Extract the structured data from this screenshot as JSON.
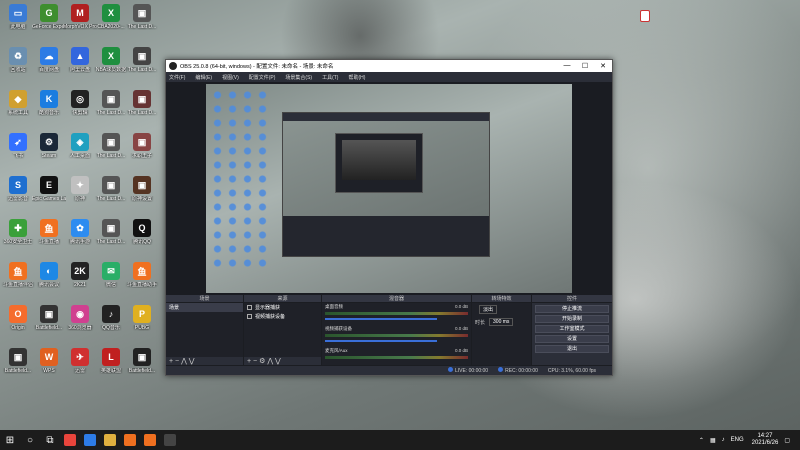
{
  "desktop_icons": [
    {
      "label": "此电脑",
      "color": "#3a7bd5",
      "glyph": "▭",
      "icon": "computer-icon"
    },
    {
      "label": "GeForce Experience",
      "color": "#3e8e2f",
      "glyph": "G",
      "icon": "nvidia-icon"
    },
    {
      "label": "MorphVOX Pro",
      "color": "#b02020",
      "glyph": "M",
      "icon": "morphvox-icon"
    },
    {
      "label": "CBA2020-...",
      "color": "#1f8f3f",
      "glyph": "X",
      "icon": "excel-icon"
    },
    {
      "label": "The Last D...",
      "color": "#555",
      "glyph": "▣",
      "icon": "game-icon"
    },
    {
      "label": "回收站",
      "color": "#6a8fb0",
      "glyph": "♻",
      "icon": "recycle-bin-icon"
    },
    {
      "label": "百度网盘",
      "color": "#2c7be5",
      "glyph": "☁",
      "icon": "baidu-netdisk-icon"
    },
    {
      "label": "阿里云盘",
      "color": "#3366dd",
      "glyph": "▲",
      "icon": "aliyun-icon"
    },
    {
      "label": "NBA球员数据",
      "color": "#1f8f3f",
      "glyph": "X",
      "icon": "excel-icon"
    },
    {
      "label": "The Last D...",
      "color": "#444",
      "glyph": "▣",
      "icon": "game-icon"
    },
    {
      "label": "系统工具",
      "color": "#d0a030",
      "glyph": "◆",
      "icon": "tool-icon"
    },
    {
      "label": "酷狗音乐",
      "color": "#1b7de0",
      "glyph": "K",
      "icon": "kugou-icon"
    },
    {
      "label": "快剪辑",
      "color": "#222",
      "glyph": "◎",
      "icon": "editor-icon"
    },
    {
      "label": "The Last D...",
      "color": "#555",
      "glyph": "▣",
      "icon": "game-icon"
    },
    {
      "label": "The Last D...",
      "color": "#663333",
      "glyph": "▣",
      "icon": "game-icon"
    },
    {
      "label": "飞书",
      "color": "#3370ff",
      "glyph": "➶",
      "icon": "feishu-icon"
    },
    {
      "label": "Steam",
      "color": "#1b2838",
      "glyph": "⚙",
      "icon": "steam-icon"
    },
    {
      "label": "人工桌面",
      "color": "#20a0c0",
      "glyph": "◈",
      "icon": "desktop-tool-icon"
    },
    {
      "label": "The Last D...",
      "color": "#555",
      "glyph": "▣",
      "icon": "game-icon"
    },
    {
      "label": "求职王子",
      "color": "#884444",
      "glyph": "▣",
      "icon": "photo-icon"
    },
    {
      "label": "迅雷影音",
      "color": "#1f6fd0",
      "glyph": "S",
      "icon": "player-icon"
    },
    {
      "label": "Epic Games Launcher",
      "color": "#111",
      "glyph": "E",
      "icon": "epic-icon"
    },
    {
      "label": "原神",
      "color": "#c0c0c0",
      "glyph": "✦",
      "icon": "genshin-icon"
    },
    {
      "label": "The Last D...",
      "color": "#555",
      "glyph": "▣",
      "icon": "game-icon"
    },
    {
      "label": "原神设置",
      "color": "#553322",
      "glyph": "▣",
      "icon": "photo-icon"
    },
    {
      "label": "360安全卫士",
      "color": "#3aa03a",
      "glyph": "✚",
      "icon": "security-icon"
    },
    {
      "label": "斗鱼直播",
      "color": "#f07020",
      "glyph": "鱼",
      "icon": "douyu-icon"
    },
    {
      "label": "腾讯手游",
      "color": "#2d8cf0",
      "glyph": "✿",
      "icon": "tencent-icon"
    },
    {
      "label": "The Last D...",
      "color": "#555",
      "glyph": "▣",
      "icon": "game-icon"
    },
    {
      "label": "腾讯QQ",
      "color": "#111",
      "glyph": "Q",
      "icon": "qq-icon"
    },
    {
      "label": "斗鱼直播伴侣",
      "color": "#f07020",
      "glyph": "鱼",
      "icon": "douyu-icon"
    },
    {
      "label": "腾讯会议",
      "color": "#1e88e5",
      "glyph": "◐",
      "icon": "meeting-icon"
    },
    {
      "label": "2K21",
      "color": "#222",
      "glyph": "2K",
      "icon": "nba2k-icon"
    },
    {
      "label": "微信",
      "color": "#2aae67",
      "glyph": "✉",
      "icon": "wechat-icon"
    },
    {
      "label": "斗鱼直播助手",
      "color": "#f07020",
      "glyph": "鱼",
      "icon": "douyu-icon"
    },
    {
      "label": "Origin",
      "color": "#f56c2d",
      "glyph": "O",
      "icon": "origin-icon"
    },
    {
      "label": "Battlefield...",
      "color": "#333",
      "glyph": "▣",
      "icon": "game-icon"
    },
    {
      "label": "360浏览器",
      "color": "#d04090",
      "glyph": "◉",
      "icon": "browser-icon"
    },
    {
      "label": "QQ音乐",
      "color": "#222",
      "glyph": "♪",
      "icon": "qqmusic-icon"
    },
    {
      "label": "PUBG",
      "color": "#e0b020",
      "glyph": "P",
      "icon": "pubg-icon"
    },
    {
      "label": "Battlefield...",
      "color": "#333",
      "glyph": "▣",
      "icon": "game-icon"
    },
    {
      "label": "WPS",
      "color": "#e06020",
      "glyph": "W",
      "icon": "wps-icon"
    },
    {
      "label": "迅雷",
      "color": "#d03030",
      "glyph": "✈",
      "icon": "xunlei-icon"
    },
    {
      "label": "英雄联盟",
      "color": "#c02020",
      "glyph": "L",
      "icon": "lol-icon"
    },
    {
      "label": "Battlefield...",
      "color": "#222",
      "glyph": "▣",
      "icon": "game-icon"
    }
  ],
  "obs": {
    "title": "OBS 25.0.8 (64-bit, windows) - 配置文件: 未命名 - 场景: 未命名",
    "window_controls": [
      "—",
      "☐",
      "✕"
    ],
    "menu": [
      "文件(F)",
      "编辑(E)",
      "视图(V)",
      "配置文件(P)",
      "场景集合(S)",
      "工具(T)",
      "帮助(H)"
    ],
    "docks": {
      "scenes_title": "场景",
      "sources_title": "来源",
      "mixer_title": "混音器",
      "transitions_title": "转场特效",
      "controls_title": "控件"
    },
    "scenes": [
      "场景"
    ],
    "sources": [
      "显示器捕获",
      "视频捕获设备"
    ],
    "mixer": [
      {
        "name": "桌面音频",
        "db": "0.0 dB"
      },
      {
        "name": "视频捕获设备",
        "db": "0.0 dB"
      },
      {
        "name": "麦克风/Aux",
        "db": "0.0 dB"
      }
    ],
    "transitions": {
      "type": "淡出",
      "duration_label": "时长",
      "duration": "300 ms"
    },
    "controls": [
      "停止推流",
      "开始录制",
      "工作室模式",
      "设置",
      "退出"
    ],
    "status": {
      "live": "LIVE: 00:00:00",
      "rec": "REC: 00:00:00",
      "cpu": "CPU: 3.1%, 60.00 fps"
    }
  },
  "taskbar": {
    "start": "⊞",
    "search": "○",
    "taskview": "⧉",
    "apps": [
      {
        "color": "#e8453c",
        "icon": "chrome-icon"
      },
      {
        "color": "#2d7be5",
        "icon": "app-icon"
      },
      {
        "color": "#e0b040",
        "icon": "file-explorer-icon"
      },
      {
        "color": "#f07020",
        "icon": "douyu-icon"
      },
      {
        "color": "#f07020",
        "icon": "douyu-icon"
      },
      {
        "color": "#444",
        "icon": "obs-icon"
      }
    ],
    "tray": {
      "lang": "ENG",
      "time": "14:27",
      "date": "2021/6/26"
    }
  }
}
